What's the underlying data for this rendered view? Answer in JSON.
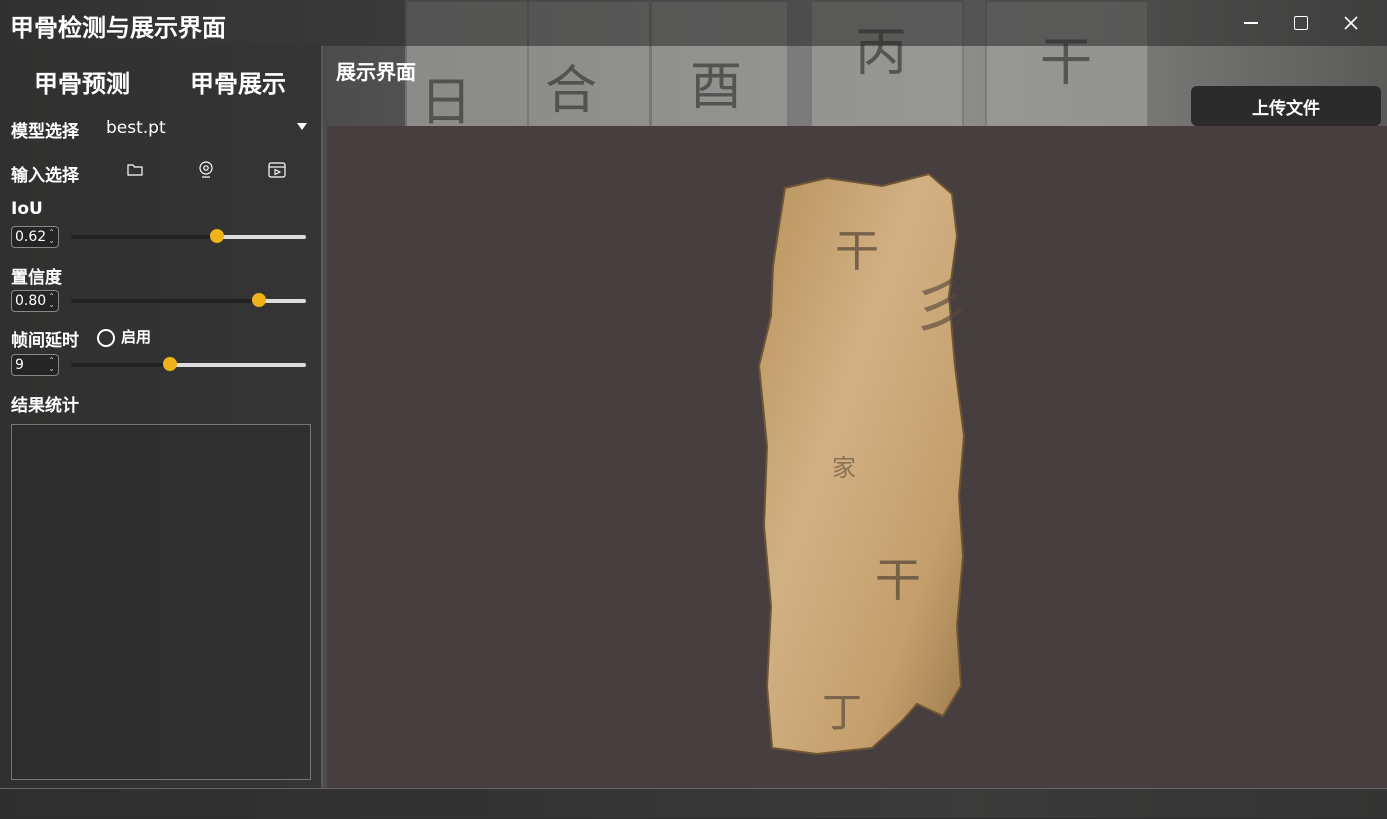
{
  "window": {
    "title": "甲骨检测与展示界面",
    "controls": [
      "minimize-icon",
      "maximize-icon",
      "close-icon"
    ]
  },
  "sidebar": {
    "tabs": [
      {
        "label": "甲骨预测"
      },
      {
        "label": "甲骨展示"
      }
    ],
    "model": {
      "label": "模型选择",
      "value": "best.pt"
    },
    "input": {
      "label": "输入选择",
      "icons": [
        "folder-icon",
        "webcam-icon",
        "video-icon"
      ]
    },
    "iou": {
      "label": "IoU",
      "value": "0.62",
      "fraction": 0.62
    },
    "confidence": {
      "label": "置信度",
      "value": "0.80",
      "fraction": 0.8
    },
    "frame_delay": {
      "label": "帧间延时",
      "enable_label": "启用",
      "enabled": false,
      "value": "9",
      "fraction": 0.42
    },
    "results": {
      "label": "结果统计"
    }
  },
  "main": {
    "title": "展示界面",
    "upload_label": "上传文件"
  },
  "colors": {
    "accent": "#f0b21a",
    "display_bg": "#473e3f",
    "bone": "#c9a878"
  },
  "background_glyphs": [
    "日",
    "合",
    "酉",
    "丙",
    "干"
  ],
  "bone_glyphs": [
    "干",
    "彡",
    "家",
    "干",
    "丁"
  ]
}
